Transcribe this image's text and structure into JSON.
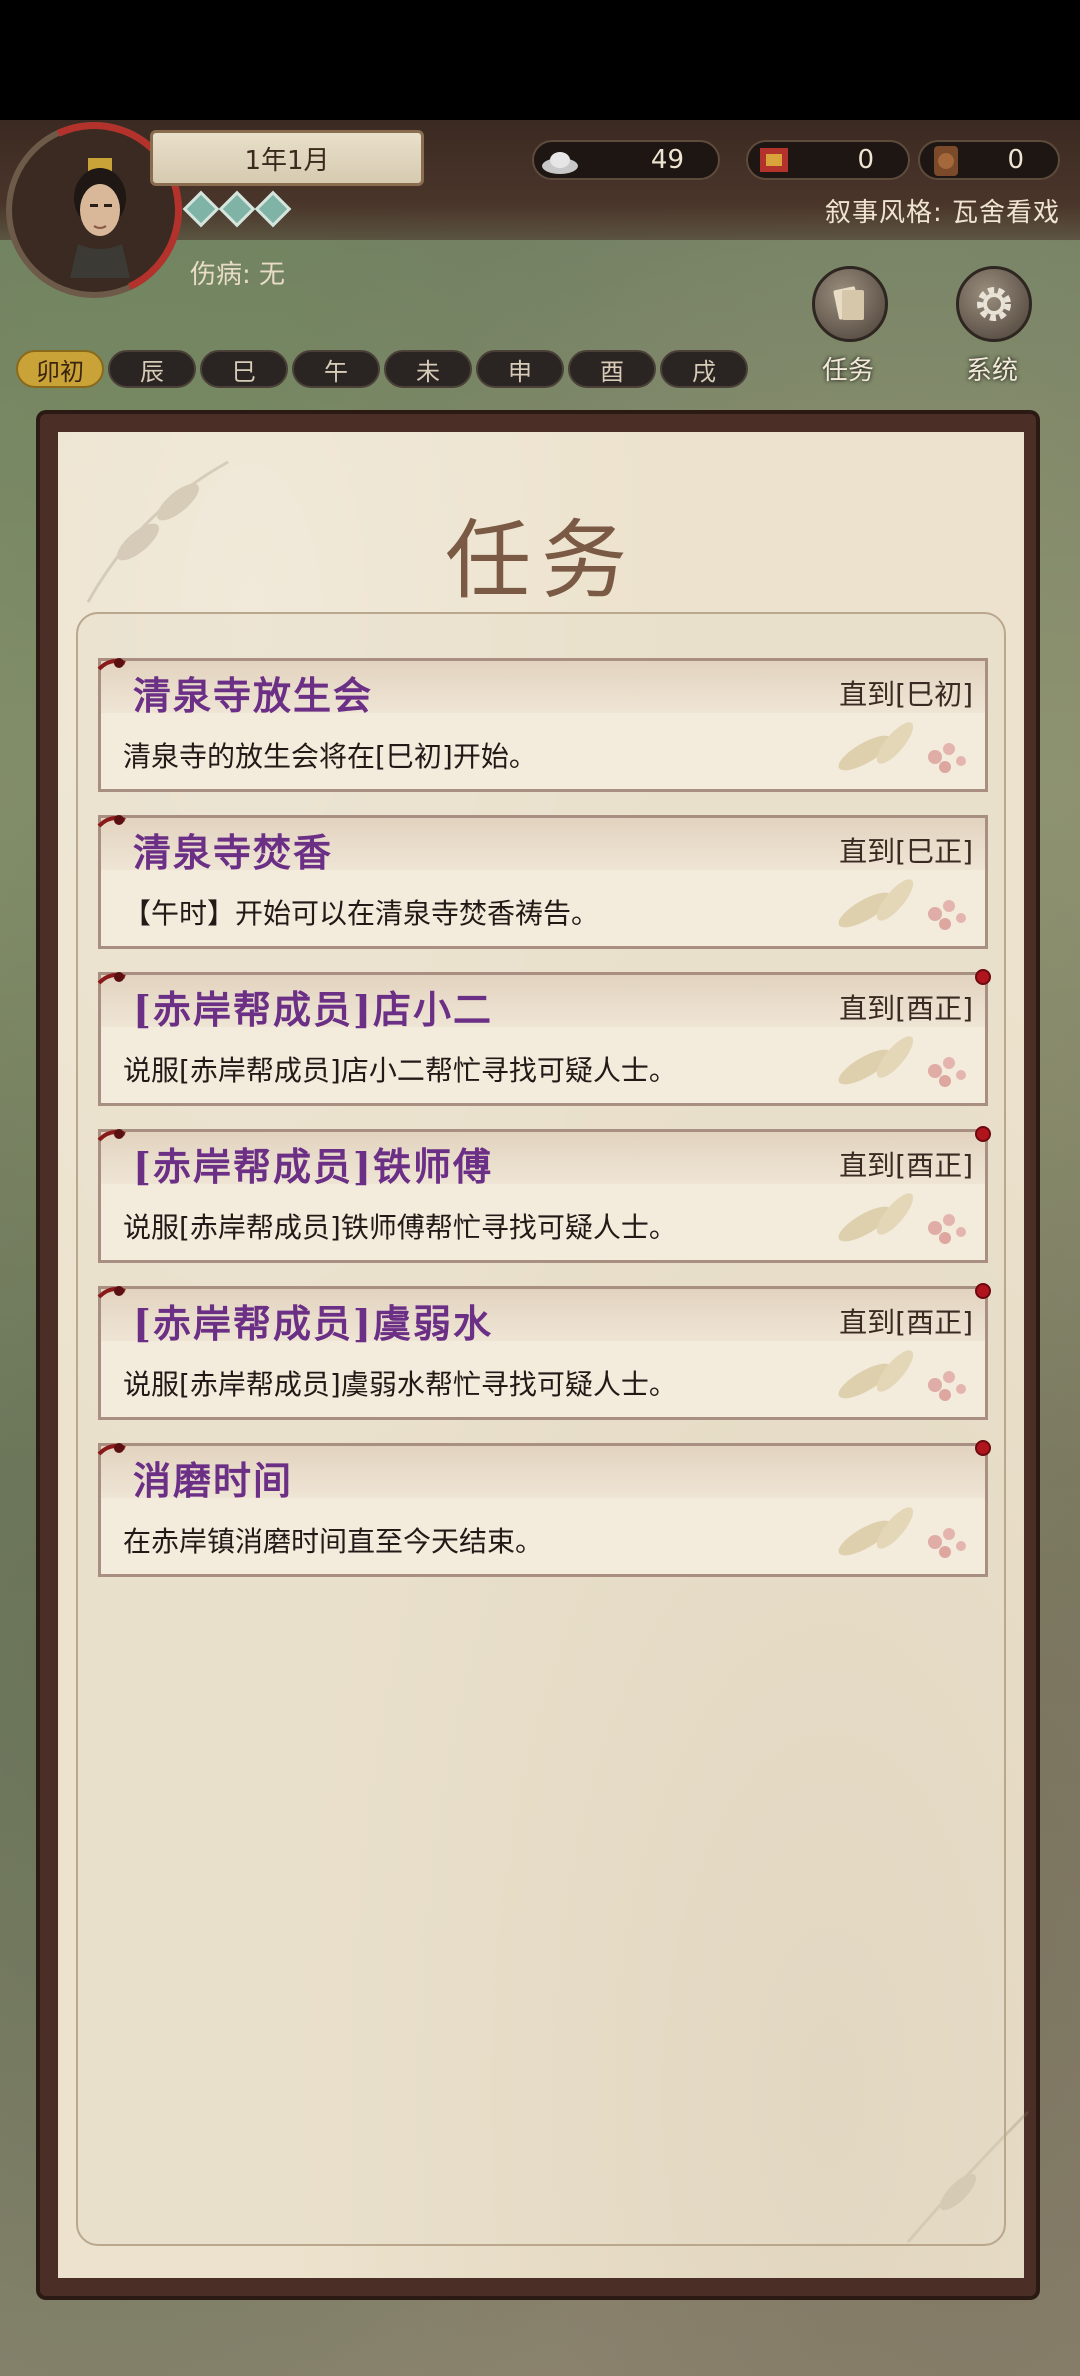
{
  "status": {
    "date": "1年1月",
    "injury": "伤病: 无",
    "narrative_style": "叙事风格: 瓦舍看戏",
    "resources": [
      {
        "icon": "silver-ingot-icon",
        "value": "49"
      },
      {
        "icon": "banner-flag-icon",
        "value": "0"
      },
      {
        "icon": "coin-icon",
        "value": "0"
      }
    ]
  },
  "buttons": {
    "tasks_label": "任务",
    "system_label": "系统"
  },
  "hours": [
    "卯初",
    "辰",
    "巳",
    "午",
    "未",
    "申",
    "酉",
    "戌"
  ],
  "active_hour_index": 0,
  "panel": {
    "title": "任务",
    "tasks": [
      {
        "title": "清泉寺放生会",
        "deadline": "直到[巳初]",
        "desc": "清泉寺的放生会将在[巳初]开始。",
        "new": false
      },
      {
        "title": "清泉寺焚香",
        "deadline": "直到[巳正]",
        "desc": "【午时】开始可以在清泉寺焚香祷告。",
        "new": false
      },
      {
        "title": "[赤岸帮成员]店小二",
        "deadline": "直到[酉正]",
        "desc": "说服[赤岸帮成员]店小二帮忙寻找可疑人士。",
        "new": true
      },
      {
        "title": "[赤岸帮成员]铁师傅",
        "deadline": "直到[酉正]",
        "desc": "说服[赤岸帮成员]铁师傅帮忙寻找可疑人士。",
        "new": true
      },
      {
        "title": "[赤岸帮成员]虞弱水",
        "deadline": "直到[酉正]",
        "desc": "说服[赤岸帮成员]虞弱水帮忙寻找可疑人士。",
        "new": true
      },
      {
        "title": "消磨时间",
        "deadline": "",
        "desc": "在赤岸镇消磨时间直至今天结束。",
        "new": true
      }
    ]
  }
}
